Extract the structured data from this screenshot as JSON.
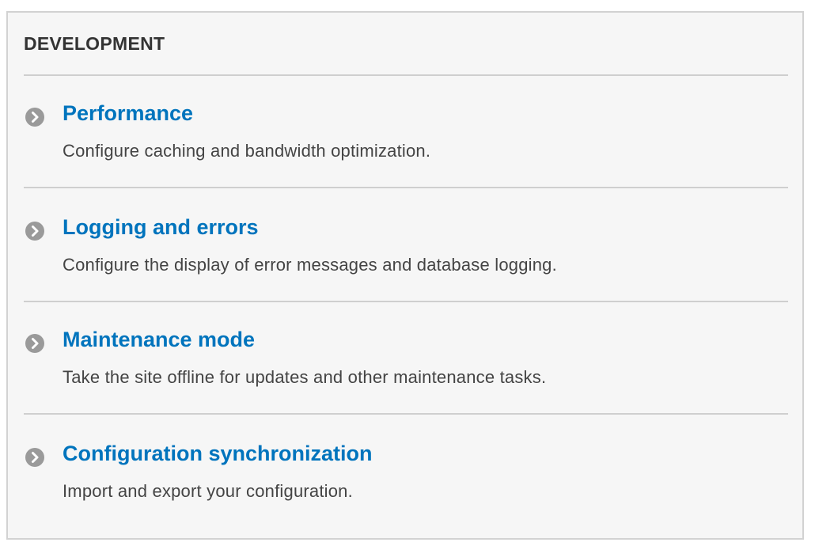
{
  "section": {
    "title": "DEVELOPMENT",
    "items": [
      {
        "label": "Performance",
        "description": "Configure caching and bandwidth optimization.",
        "icon": "chevron-right-circle-icon"
      },
      {
        "label": "Logging and errors",
        "description": "Configure the display of error messages and database logging.",
        "icon": "chevron-right-circle-icon"
      },
      {
        "label": "Maintenance mode",
        "description": "Take the site offline for updates and other maintenance tasks.",
        "icon": "chevron-right-circle-icon"
      },
      {
        "label": "Configuration synchronization",
        "description": "Import and export your configuration.",
        "icon": "chevron-right-circle-icon"
      }
    ]
  },
  "colors": {
    "link": "#0074bd",
    "text": "#444444",
    "heading": "#333333",
    "panel_background": "#f6f6f6",
    "border": "#d2d2d2",
    "icon": "#9a9a9a"
  }
}
